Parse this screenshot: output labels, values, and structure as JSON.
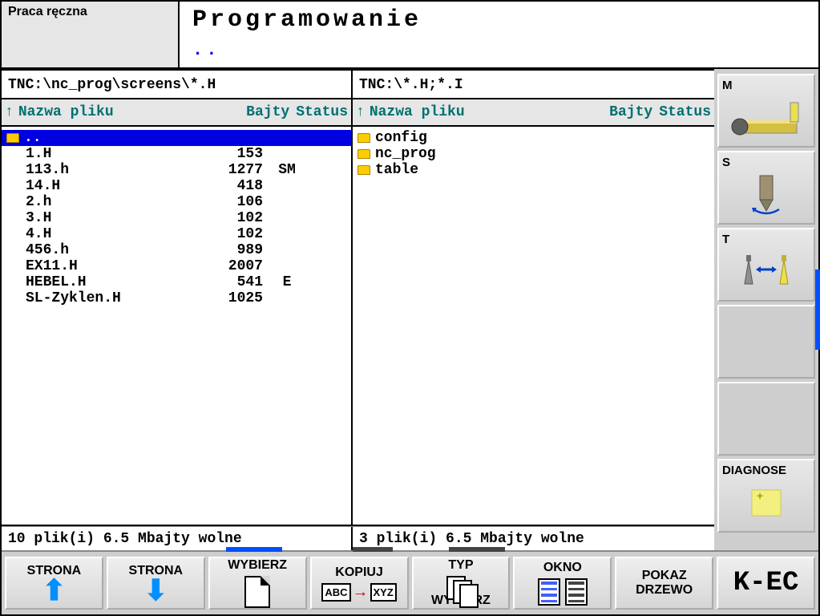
{
  "header": {
    "manual_tab": "Praca ręczna",
    "program_tab": "Programowanie",
    "dots": ".."
  },
  "paths": {
    "left": "TNC:\\nc_prog\\screens\\*.H",
    "right": "TNC:\\*.H;*.I"
  },
  "columns": {
    "name": "Nazwa pliku",
    "bytes": "Bajty",
    "status": "Status"
  },
  "left_pane": {
    "files": [
      {
        "name": "..",
        "bytes": "",
        "status": "",
        "folder": true,
        "selected": true
      },
      {
        "name": "1.H",
        "bytes": "153",
        "status": ""
      },
      {
        "name": "113.h",
        "bytes": "1277",
        "status": "SM"
      },
      {
        "name": "14.H",
        "bytes": "418",
        "status": ""
      },
      {
        "name": "2.h",
        "bytes": "106",
        "status": ""
      },
      {
        "name": "3.H",
        "bytes": "102",
        "status": ""
      },
      {
        "name": "4.H",
        "bytes": "102",
        "status": ""
      },
      {
        "name": "456.h",
        "bytes": "989",
        "status": ""
      },
      {
        "name": "EX11.H",
        "bytes": "2007",
        "status": ""
      },
      {
        "name": "HEBEL.H",
        "bytes": "541",
        "status": "E"
      },
      {
        "name": "SL-Zyklen.H",
        "bytes": "1025",
        "status": ""
      }
    ],
    "status": "10  plik(i)    6.5 Mbajty wolne"
  },
  "right_pane": {
    "files": [
      {
        "name": "config",
        "bytes": "",
        "status": "",
        "folder": true
      },
      {
        "name": "nc_prog",
        "bytes": "",
        "status": "",
        "folder": true
      },
      {
        "name": "table",
        "bytes": "",
        "status": "",
        "folder": true
      }
    ],
    "status": "3   plik(i)    6.5 Mbajty wolne"
  },
  "sidebar": {
    "m": "M",
    "s": "S",
    "t": "T",
    "diagnose": "DIAGNOSE"
  },
  "softkeys": {
    "page_up": "STRONA",
    "page_down": "STRONA",
    "select": "WYBIERZ",
    "copy": "KOPIUJ",
    "copy_abc": "ABC",
    "copy_xyz": "XYZ",
    "type1": "TYP",
    "type2": "WYBIERZ",
    "window": "OKNO",
    "show1": "POKAZ",
    "show2": "DRZEWO",
    "kec": "K-EC"
  }
}
